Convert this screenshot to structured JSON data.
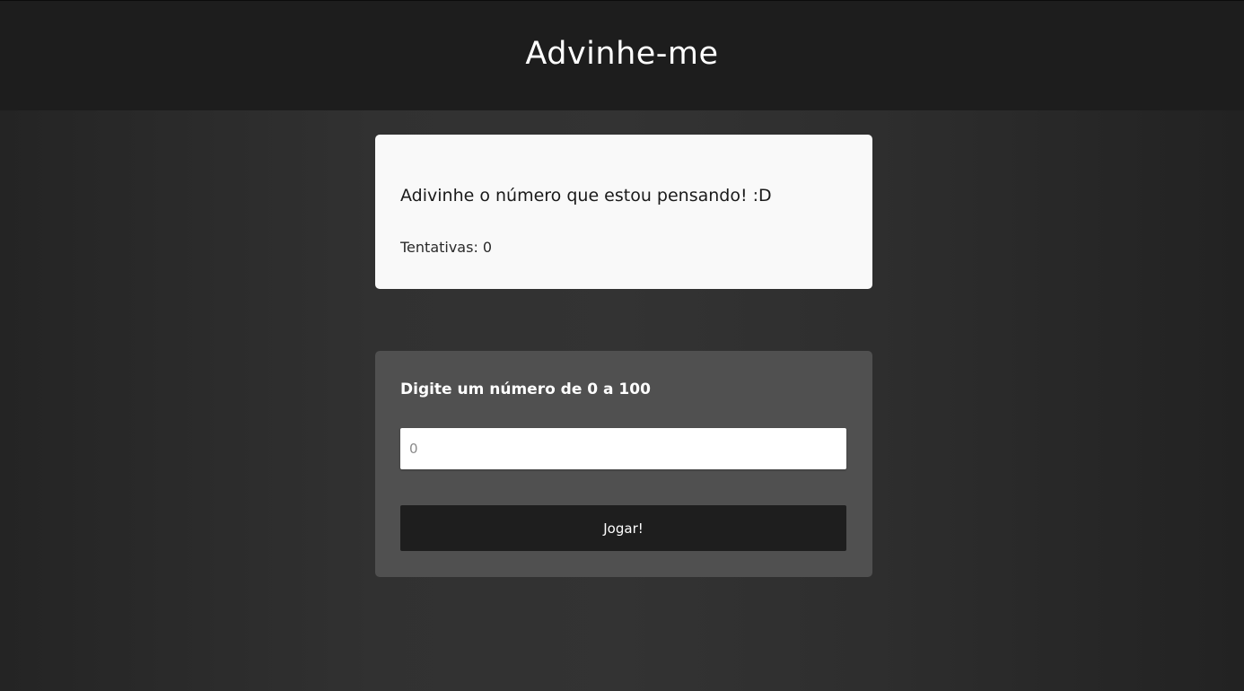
{
  "header": {
    "title": "Advinhe-me"
  },
  "info": {
    "message": "Adivinhe o número que estou pensando! :D",
    "tries_label": "Tentativas: 0"
  },
  "form": {
    "prompt": "Digite um número de 0 a 100",
    "input_placeholder": "0",
    "submit_label": "Jogar!"
  }
}
